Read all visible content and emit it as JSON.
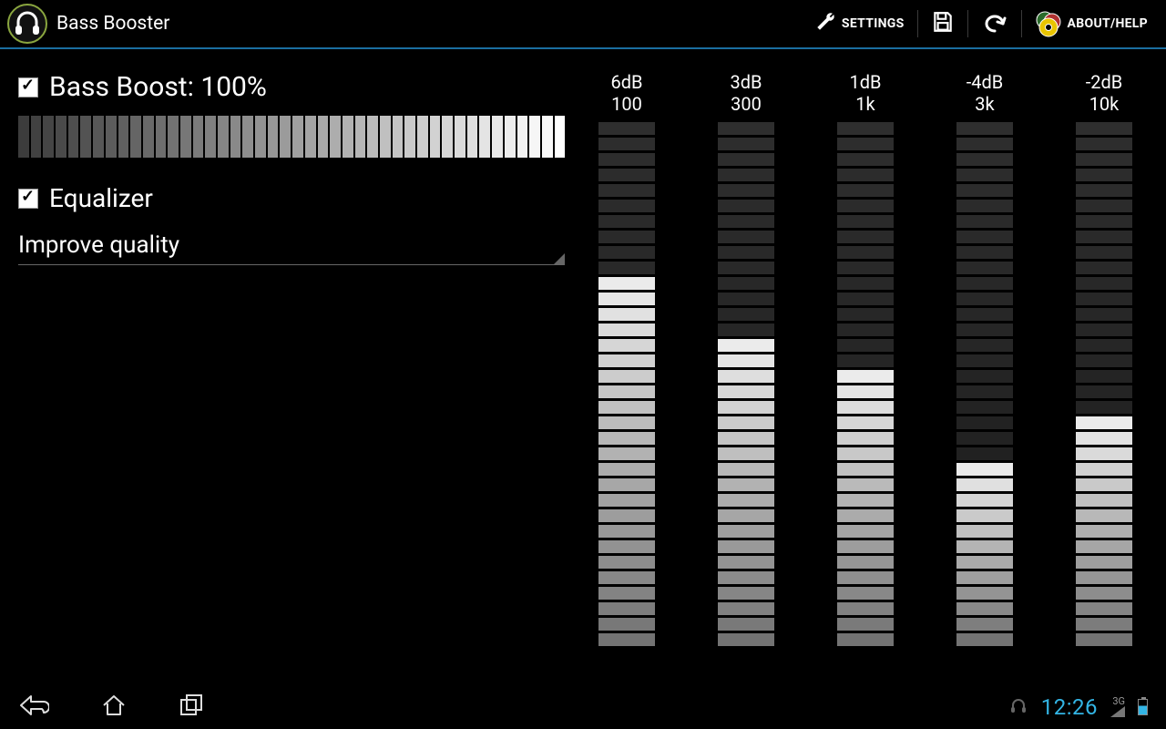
{
  "actionbar": {
    "title": "Bass Booster",
    "settings_label": "SETTINGS",
    "about_label": "ABOUT/HELP"
  },
  "bass_boost": {
    "checked": true,
    "label": "Bass Boost: 100%",
    "value_pct": 100,
    "segments": 44
  },
  "equalizer": {
    "checked": true,
    "label": "Equalizer",
    "preset_selected": "Improve quality",
    "segments_per_band": 34,
    "db_min": -15,
    "db_max": 15,
    "bands": [
      {
        "db_label": "6dB",
        "freq_label": "100",
        "db": 6
      },
      {
        "db_label": "3dB",
        "freq_label": "300",
        "db": 3
      },
      {
        "db_label": "1dB",
        "freq_label": "1k",
        "db": 1
      },
      {
        "db_label": "-4dB",
        "freq_label": "3k",
        "db": -4
      },
      {
        "db_label": "-2dB",
        "freq_label": "10k",
        "db": -2
      }
    ]
  },
  "statusbar": {
    "clock": "12:26",
    "net": "3G"
  },
  "colors": {
    "holo_blue": "#33b5e5",
    "inactive_dark": "#1c1c1c",
    "inactive_light_top": "#2e2e2e"
  }
}
